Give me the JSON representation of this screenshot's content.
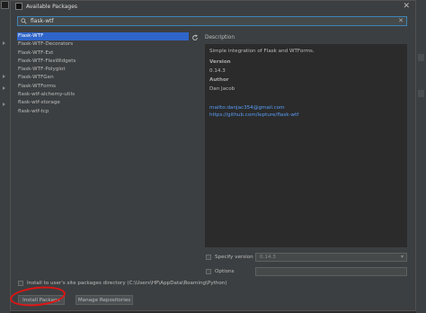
{
  "dialog": {
    "title": "Available Packages",
    "close_icon": "✕"
  },
  "search": {
    "value": "flask-wtf",
    "clear_icon": "✕"
  },
  "packages": [
    "Flask-WTF",
    "Flask-WTF-Decorators",
    "Flask-WTF-Ext",
    "Flask-WTF-FlexWidgets",
    "Flask-WTF-Polyglot",
    "Flask-WTFGen",
    "Flask-WTForms",
    "flask-wtf-alchemy-utils",
    "flask-wtf-storage",
    "flask-wtf-tcp"
  ],
  "description": {
    "label": "Description",
    "summary": "Simple integration of Flask and WTForms.",
    "version_label": "Version",
    "version": "0.14.3",
    "author_label": "Author",
    "author": "Dan Jacob",
    "email": "mailto:danjac354@gmail.com",
    "url": "https://github.com/lepture/flask-wtf"
  },
  "specify_version": {
    "label": "Specify version",
    "value": "0.14.3",
    "dropdown_icon": "▾"
  },
  "options": {
    "label": "Options"
  },
  "install_to_user": {
    "label": "Install to user's site packages directory (C:\\Users\\HP\\AppData\\Roaming\\Python)"
  },
  "buttons": {
    "install": "Install Package",
    "manage": "Manage Repositories"
  },
  "colors": {
    "selection": "#2f65ca",
    "accent": "#3d84b8",
    "link": "#589df6",
    "annotation": "#e01414"
  }
}
